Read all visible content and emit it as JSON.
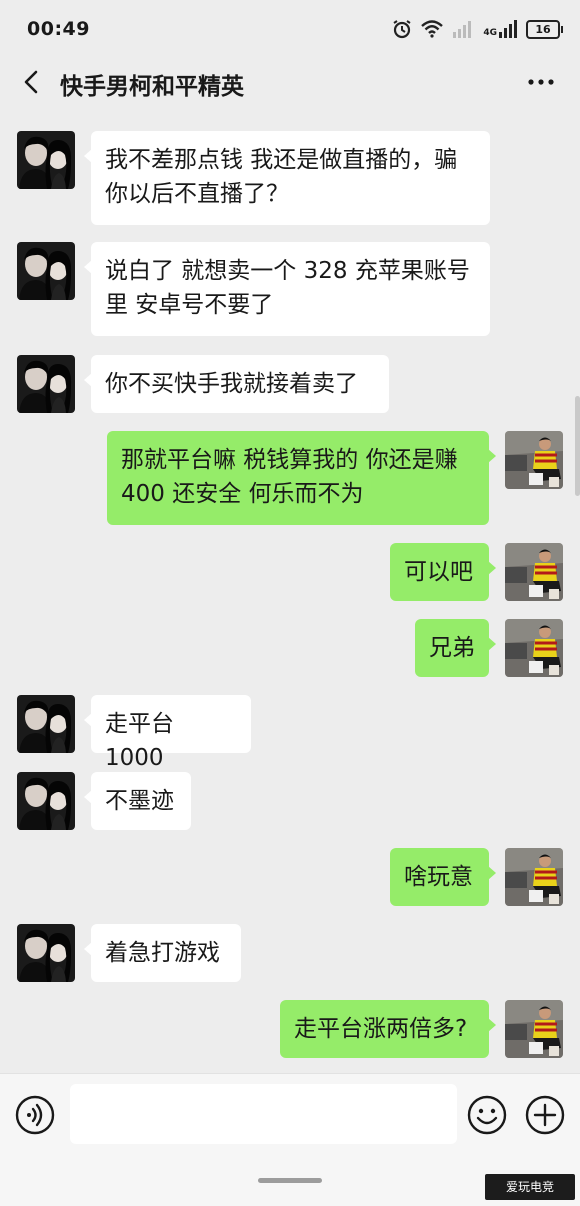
{
  "status_bar": {
    "time": "00:49",
    "network": "4G",
    "battery": "16",
    "icons": [
      "alarm-icon",
      "wifi-icon",
      "signal-bars-icon",
      "4g-signal-icon",
      "battery-icon"
    ]
  },
  "header": {
    "title": "快手男柯和平精英",
    "back_icon": "chevron-left-icon",
    "more_icon": "more-dots-icon"
  },
  "messages": [
    {
      "side": "left",
      "text": "我不差那点钱 我还是做直播的，骗\n你以后不直播了？"
    },
    {
      "side": "left",
      "text": "说白了 就想卖一个 328 充苹果账号\n里 安卓号不要了"
    },
    {
      "side": "left",
      "text": "你不买快手我就接着卖了"
    },
    {
      "side": "right",
      "text": "那就平台嘛 税钱算我的 你还是赚\n400 还安全 何乐而不为"
    },
    {
      "side": "right",
      "text": "可以吧"
    },
    {
      "side": "right",
      "text": "兄弟"
    },
    {
      "side": "left",
      "text": "走平台 1000"
    },
    {
      "side": "left",
      "text": "不墨迹"
    },
    {
      "side": "right",
      "text": "啥玩意"
    },
    {
      "side": "left",
      "text": "着急打游戏"
    },
    {
      "side": "right",
      "text": "走平台涨两倍多?"
    }
  ],
  "input_bar": {
    "voice_icon": "voice-icon",
    "input_value": "",
    "emoji_icon": "emoji-icon",
    "plus_icon": "plus-icon"
  },
  "watermark": "爱玩电竞",
  "colors": {
    "background": "#ededed",
    "bubble_self": "#95ec69",
    "bubble_other": "#ffffff"
  }
}
